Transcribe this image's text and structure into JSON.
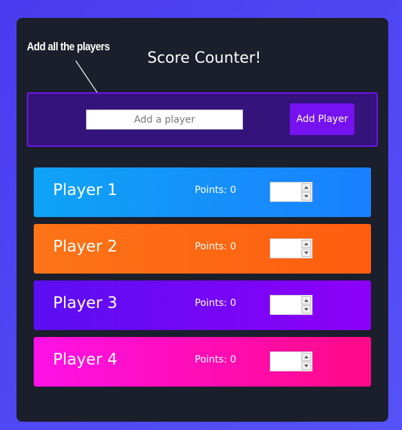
{
  "annotation": {
    "text": "Add all the players"
  },
  "header": {
    "title": "Score Counter!"
  },
  "add_player": {
    "input_value": "",
    "input_placeholder": "Add a player",
    "button_label": "Add Player"
  },
  "players": [
    {
      "name": "Player 1",
      "points_label": "Points: 0",
      "stepper_value": "",
      "gradient_start": "#0fa3f6",
      "gradient_end": "#1a80ff"
    },
    {
      "name": "Player 2",
      "points_label": "Points: 0",
      "stepper_value": "",
      "gradient_start": "#fc7417",
      "gradient_end": "#fe5d0f"
    },
    {
      "name": "Player 3",
      "points_label": "Points: 0",
      "stepper_value": "",
      "gradient_start": "#5b0ef2",
      "gradient_end": "#8d00f8"
    },
    {
      "name": "Player 4",
      "points_label": "Points: 0",
      "stepper_value": "",
      "gradient_start": "#ff11e6",
      "gradient_end": "#ff0a87"
    }
  ],
  "colors": {
    "page_background": "#4f46f4",
    "panel_background": "#1b1e2b",
    "add_bar_background": "#34137a",
    "add_bar_border": "#6d16f0",
    "add_button": "#7612f0"
  },
  "icons": {
    "annotation_pointer": "arrow-icon",
    "stepper_increment": "triangle-up-icon",
    "stepper_decrement": "triangle-down-icon"
  }
}
